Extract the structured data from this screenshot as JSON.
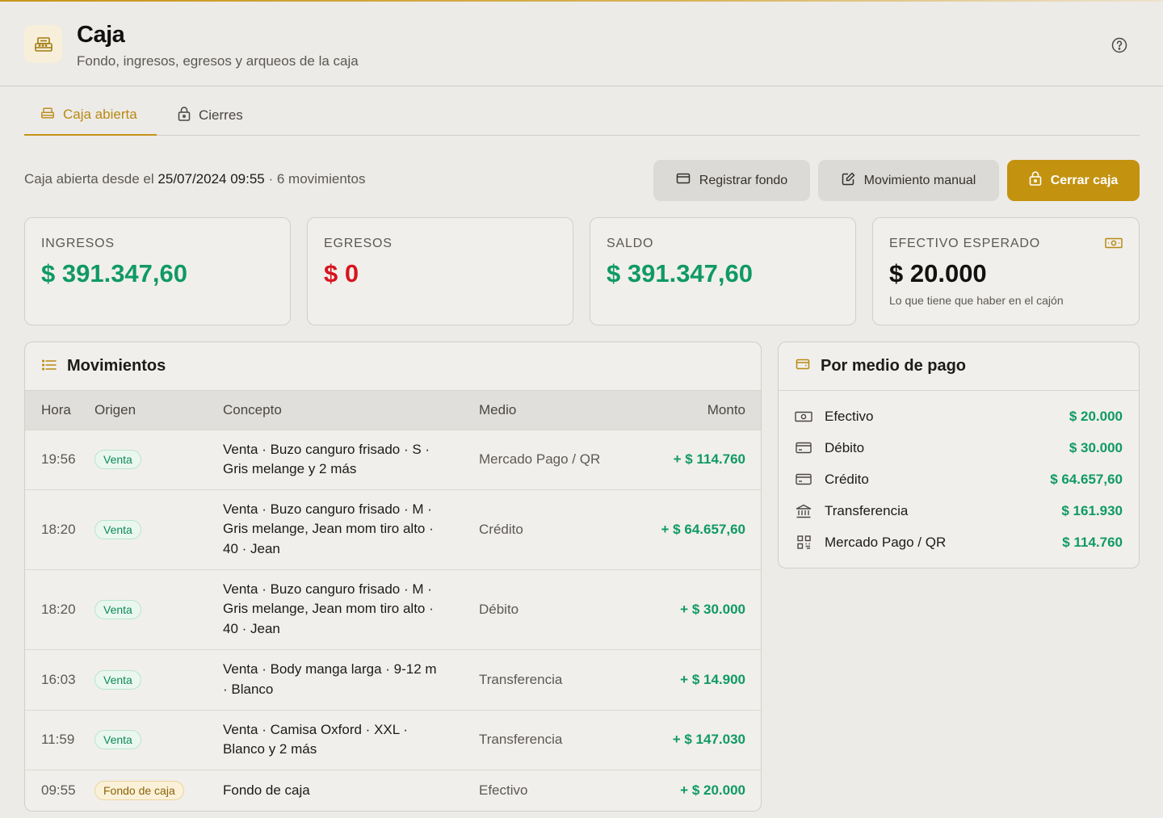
{
  "header": {
    "title": "Caja",
    "subtitle": "Fondo, ingresos, egresos y arqueos de la caja"
  },
  "tabs": [
    {
      "label": "Caja abierta",
      "active": true
    },
    {
      "label": "Cierres",
      "active": false
    }
  ],
  "status": {
    "prefix": "Caja abierta desde el",
    "datetime": "25/07/2024 09:55",
    "suffix": "· 6 movimientos"
  },
  "actions": {
    "registrar_fondo": "Registrar fondo",
    "movimiento_manual": "Movimiento manual",
    "cerrar_caja": "Cerrar caja"
  },
  "stats": {
    "ingresos": {
      "label": "INGRESOS",
      "value": "$ 391.347,60"
    },
    "egresos": {
      "label": "EGRESOS",
      "value": "$ 0"
    },
    "saldo": {
      "label": "SALDO",
      "value": "$ 391.347,60"
    },
    "efectivo": {
      "label": "EFECTIVO ESPERADO",
      "value": "$ 20.000",
      "note": "Lo que tiene que haber en el cajón"
    }
  },
  "movimientos": {
    "title": "Movimientos",
    "columns": {
      "hora": "Hora",
      "origen": "Origen",
      "concepto": "Concepto",
      "medio": "Medio",
      "monto": "Monto"
    },
    "rows": [
      {
        "hora": "19:56",
        "origen": "Venta",
        "concepto_1": "Venta · Buzo canguro frisado · S ·",
        "concepto_2": "Gris melange y 2 más",
        "concepto_3": "",
        "medio": "Mercado Pago / QR",
        "monto": "+ $ 114.760"
      },
      {
        "hora": "18:20",
        "origen": "Venta",
        "concepto_1": "Venta · Buzo canguro frisado · M ·",
        "concepto_2": "Gris melange, Jean mom tiro alto ·",
        "concepto_3": "40 · Jean",
        "medio": "Crédito",
        "monto": "+ $ 64.657,60"
      },
      {
        "hora": "18:20",
        "origen": "Venta",
        "concepto_1": "Venta · Buzo canguro frisado · M ·",
        "concepto_2": "Gris melange, Jean mom tiro alto ·",
        "concepto_3": "40 · Jean",
        "medio": "Débito",
        "monto": "+ $ 30.000"
      },
      {
        "hora": "16:03",
        "origen": "Venta",
        "concepto_1": "Venta · Body manga larga · 9-12 m",
        "concepto_2": "· Blanco",
        "concepto_3": "",
        "medio": "Transferencia",
        "monto": "+ $ 14.900"
      },
      {
        "hora": "11:59",
        "origen": "Venta",
        "concepto_1": "Venta · Camisa Oxford · XXL ·",
        "concepto_2": "Blanco y 2 más",
        "concepto_3": "",
        "medio": "Transferencia",
        "monto": "+ $ 147.030"
      },
      {
        "hora": "09:55",
        "origen": "Fondo de caja",
        "concepto_1": "Fondo de caja",
        "concepto_2": "",
        "concepto_3": "",
        "medio": "Efectivo",
        "monto": "+ $ 20.000"
      }
    ]
  },
  "medios_pago": {
    "title": "Por medio de pago",
    "items": [
      {
        "label": "Efectivo",
        "value": "$ 20.000",
        "icon": "cash-icon"
      },
      {
        "label": "Débito",
        "value": "$ 30.000",
        "icon": "card-icon"
      },
      {
        "label": "Crédito",
        "value": "$ 64.657,60",
        "icon": "card-icon"
      },
      {
        "label": "Transferencia",
        "value": "$ 161.930",
        "icon": "bank-icon"
      },
      {
        "label": "Mercado Pago / QR",
        "value": "$ 114.760",
        "icon": "qr-icon"
      }
    ]
  },
  "colors": {
    "accent": "#c3920f",
    "positive": "#0f9a63",
    "negative": "#d8141e",
    "background": "#edebe8"
  }
}
